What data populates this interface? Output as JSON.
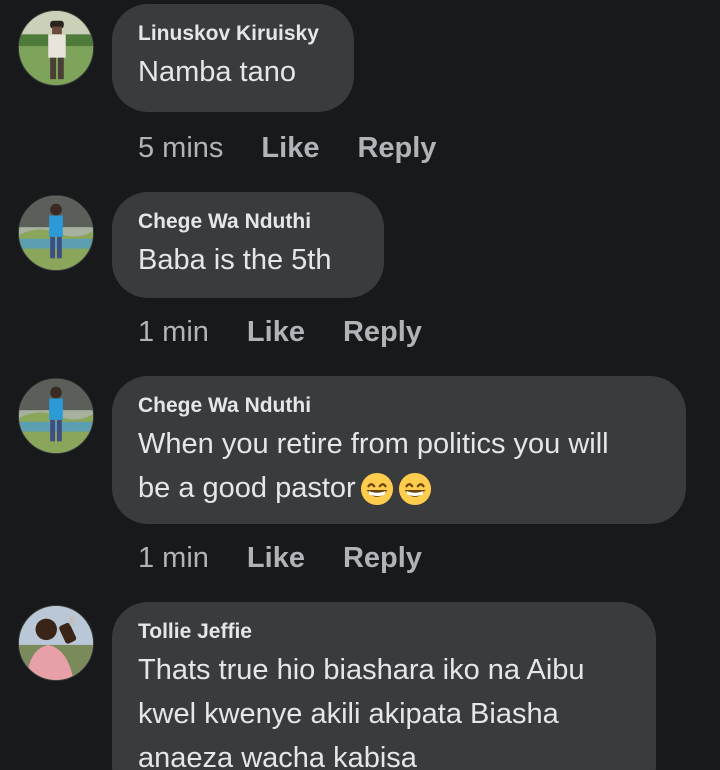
{
  "comments": [
    {
      "author": "Linuskov Kiruisky",
      "text": "Namba tano",
      "time": "5 mins",
      "like_label": "Like",
      "reply_label": "Reply"
    },
    {
      "author": "Chege Wa Nduthi",
      "text": "Baba is the 5th",
      "time": "1 min",
      "like_label": "Like",
      "reply_label": "Reply"
    },
    {
      "author": "Chege Wa Nduthi",
      "text_line1": "When you retire from politics you will",
      "text_line2": "be a good pastor",
      "emojis": [
        "grinning-face-emoji",
        "grinning-face-emoji"
      ],
      "time": "1 min",
      "like_label": "Like",
      "reply_label": "Reply"
    },
    {
      "author": "Tollie Jeffie",
      "text_line1": "Thats true hio biashara iko na Aibu",
      "text_line2": "kwel kwenye akili akipata Biasha",
      "text_line3": "anaeza wacha kabisa"
    }
  ],
  "colors": {
    "background": "#18191a",
    "bubble": "#3a3b3c",
    "primary_text": "#e4e6eb",
    "secondary_text": "#b0b3b8"
  }
}
